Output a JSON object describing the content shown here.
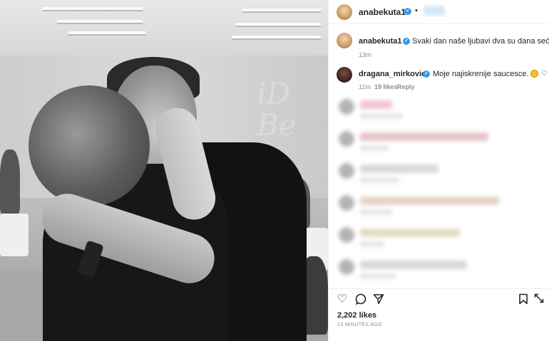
{
  "post": {
    "author": "anabekuta1",
    "header_separator": "•",
    "caption": "Svaki dan naše ljubavi dva su dana sećanja.",
    "caption_time": "13m",
    "watermark": "iD\nBe",
    "likes": "2,202 likes",
    "posted_ago": "13 MINUTES AGO"
  },
  "comment": {
    "author": "dragana_mirkovic",
    "text": "Moje najiskrenije saucesce.",
    "time": "11m",
    "likes": "19 likes",
    "reply": "Reply"
  },
  "icons": {
    "verified": "verified-badge-icon",
    "comment_like": "heart-outline-icon",
    "like": "heart-icon",
    "comment": "comment-bubble-icon",
    "share": "paper-plane-icon",
    "save": "bookmark-icon"
  },
  "colors": {
    "verified_blue": "#3897f0",
    "text": "#262626",
    "muted": "#8e8e8e"
  }
}
